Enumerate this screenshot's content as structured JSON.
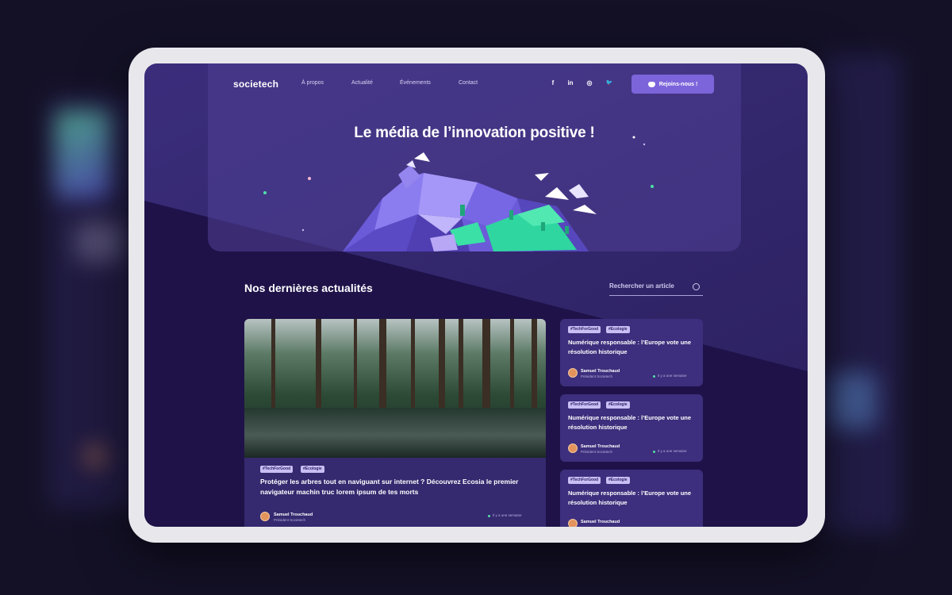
{
  "nav": {
    "logo": "societech",
    "links": [
      "À propos",
      "Actualité",
      "Événements",
      "Contact"
    ],
    "social_icons": [
      "facebook-icon",
      "linkedin-icon",
      "instagram-icon",
      "twitter-icon"
    ],
    "social_glyphs": [
      "f",
      "in",
      "◎",
      "🐦"
    ],
    "join_button": "Rejoins-nous !"
  },
  "hero": {
    "title": "Le média de l’innovation positive !"
  },
  "news": {
    "section_title": "Nos dernières actualités",
    "search_placeholder": "Rechercher un article",
    "featured": {
      "tags": [
        "#TechForGood",
        "#Ecologie"
      ],
      "title": "Protéger les arbres tout en naviguant sur internet ? Découvrez Ecosia le premier navigateur machin truc lorem ipsum de tes morts",
      "author_name": "Samuel Trouchaud",
      "author_role": "Président Societech",
      "time": "Il y a une semaine"
    },
    "side_articles": [
      {
        "tags": [
          "#TechForGood",
          "#Ecologie"
        ],
        "title": "Numérique responsable : l’Europe vote une résolution historique",
        "author_name": "Samuel Trouchaud",
        "author_role": "Président Societech",
        "time": "Il y a une semaine"
      },
      {
        "tags": [
          "#TechForGood",
          "#Ecologie"
        ],
        "title": "Numérique responsable : l’Europe vote une résolution historique",
        "author_name": "Samuel Trouchaud",
        "author_role": "Président Societech",
        "time": "Il y a une semaine"
      },
      {
        "tags": [
          "#TechForGood",
          "#Ecologie"
        ],
        "title": "Numérique responsable : l’Europe vote une résolution historique",
        "author_name": "Samuel Trouchaud",
        "author_role": "Président Societech",
        "time": ""
      }
    ]
  },
  "colors": {
    "accent": "#7c64db",
    "background": "#141127",
    "card": "#3d2f7d",
    "tag": "#c9bff4",
    "status_dot": "#53e0a7"
  }
}
